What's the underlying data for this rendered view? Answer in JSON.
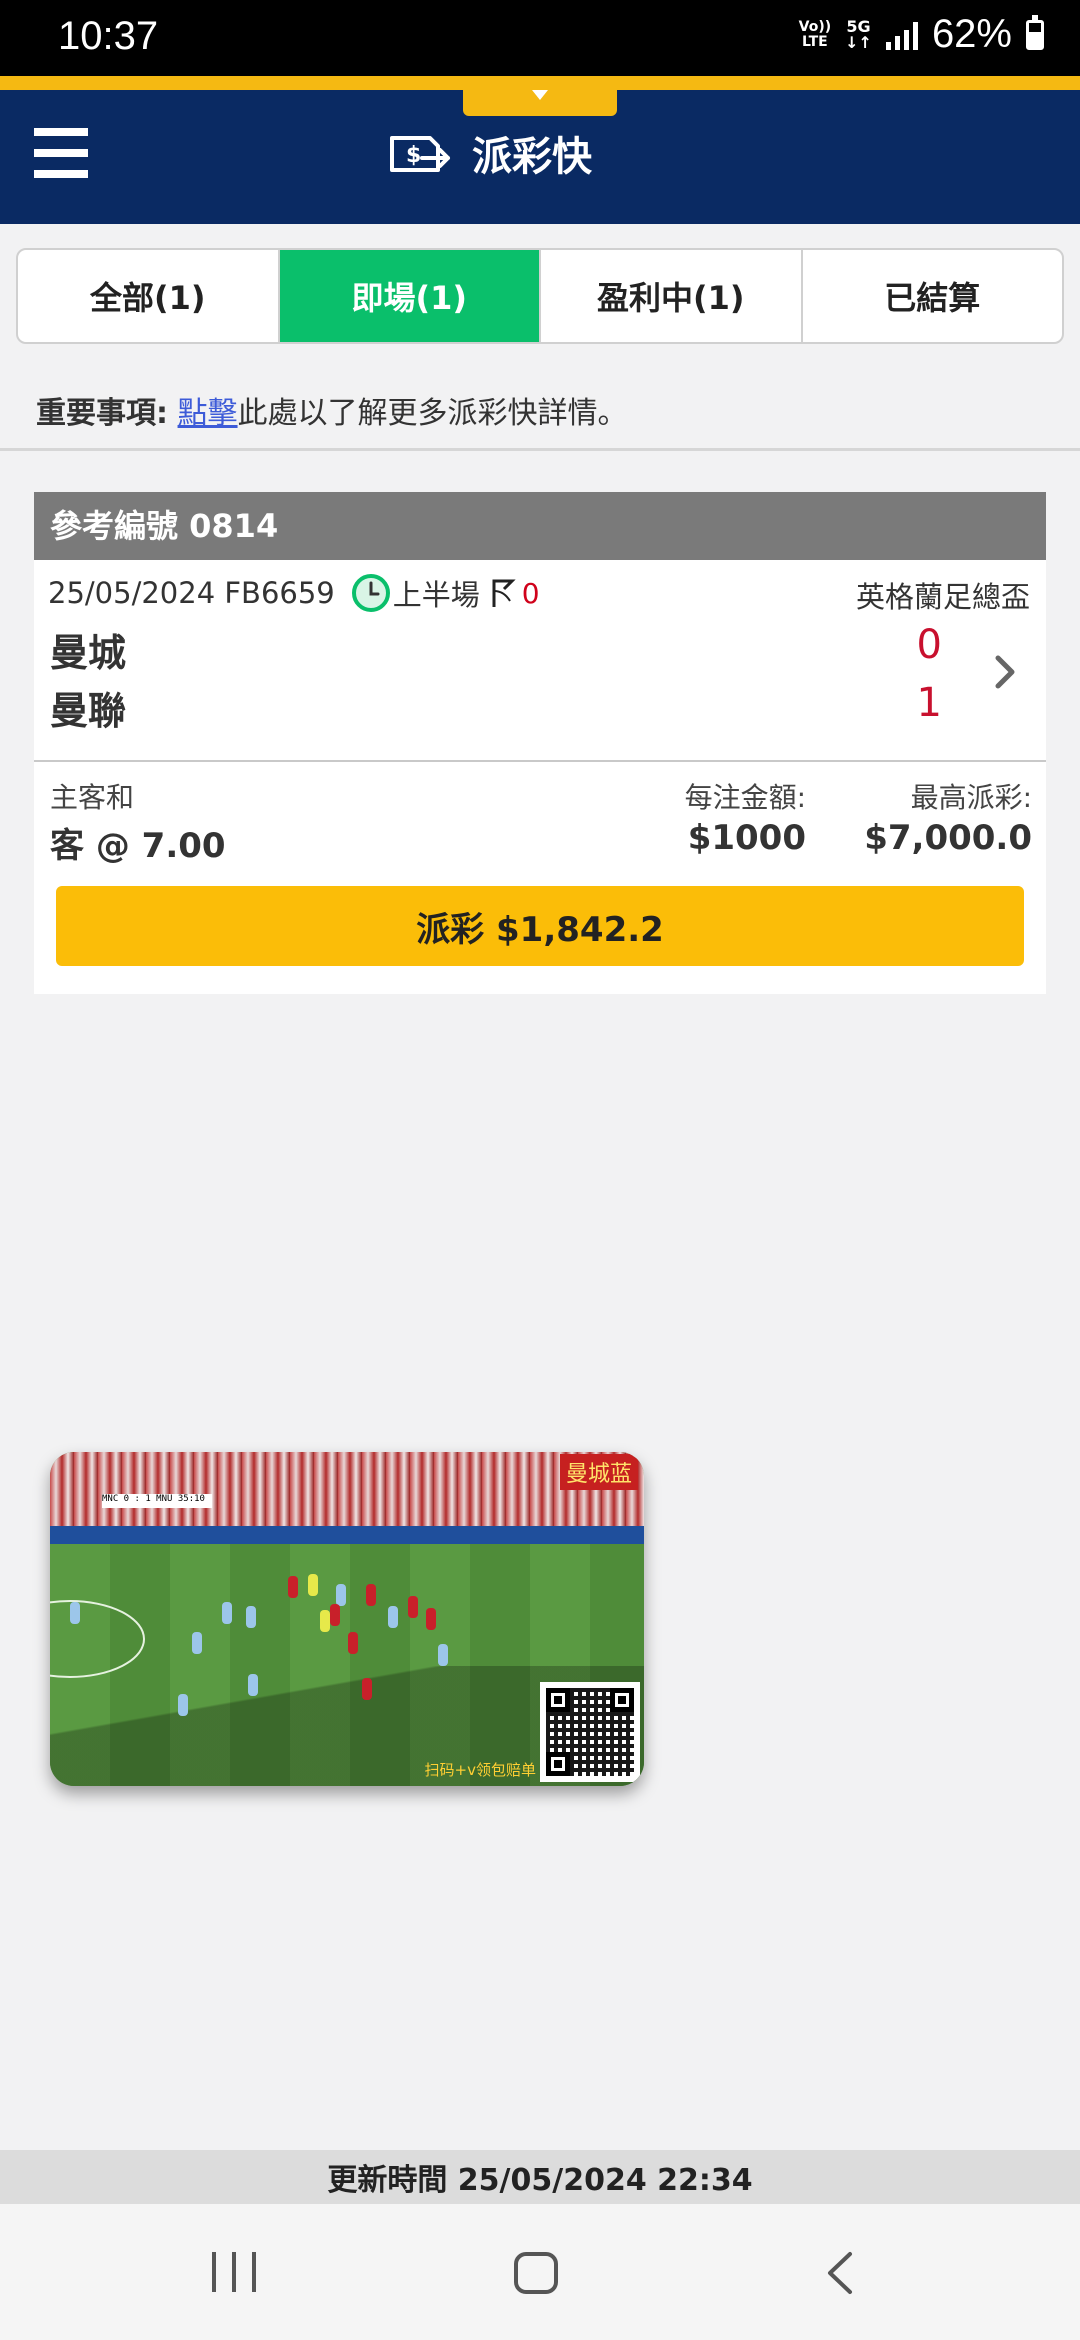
{
  "status_bar": {
    "time": "10:37",
    "network_top": "Vo))",
    "network_bottom": "LTE",
    "fiveg": "5G",
    "battery": "62%"
  },
  "header": {
    "title": "派彩快"
  },
  "tabs": [
    {
      "label": "全部(1)",
      "active": false
    },
    {
      "label": "即場(1)",
      "active": true
    },
    {
      "label": "盈利中(1)",
      "active": false
    },
    {
      "label": "已結算",
      "active": false
    }
  ],
  "notice": {
    "prefix": "重要事項:",
    "link": "點擊",
    "suffix": "此處以了解更多派彩快詳情。"
  },
  "bet": {
    "reference": "參考編號 0814",
    "match_date_code": "25/05/2024 FB6659",
    "period": "上半場",
    "corners": "0",
    "league": "英格蘭足總盃",
    "home_team": "曼城",
    "away_team": "曼聯",
    "home_score": "0",
    "away_score": "1",
    "market_label": "主客和",
    "selection": "客 @ 7.00",
    "stake_label": "每注金額:",
    "stake": "$1000",
    "max_payout_label": "最高派彩:",
    "max_payout": "$7,000.0",
    "payout_button": "派彩 $1,842.2"
  },
  "video": {
    "tag": "曼城蓝",
    "caption": "扫码+v领包赔单",
    "scorebug": "MNC 0 : 1 MNU 35:10"
  },
  "footer": {
    "update_time": "更新時間 25/05/2024 22:34"
  },
  "colors": {
    "header_bg": "#0a2a63",
    "accent_gold": "#f5b912",
    "active_tab": "#0abf6b",
    "payout_button": "#fbbd08",
    "score_red": "#c8102e"
  }
}
